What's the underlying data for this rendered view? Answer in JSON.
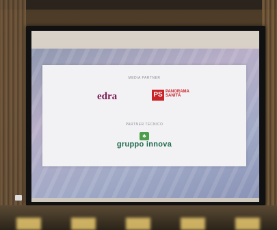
{
  "slide": {
    "media_partner_label": "MEDIA PARTNER",
    "partner_tecnico_label": "PARTNER TECNICO",
    "edra_logo": "edra",
    "edra_sub": "",
    "ps_mark": "PS",
    "ps_line1": "PANORAMA",
    "ps_line2": "SANITÀ",
    "innova_logo": "gruppo innova"
  },
  "colors": {
    "edra": "#7a1b55",
    "panorama": "#c8252b",
    "innova": "#1f6b4f"
  }
}
